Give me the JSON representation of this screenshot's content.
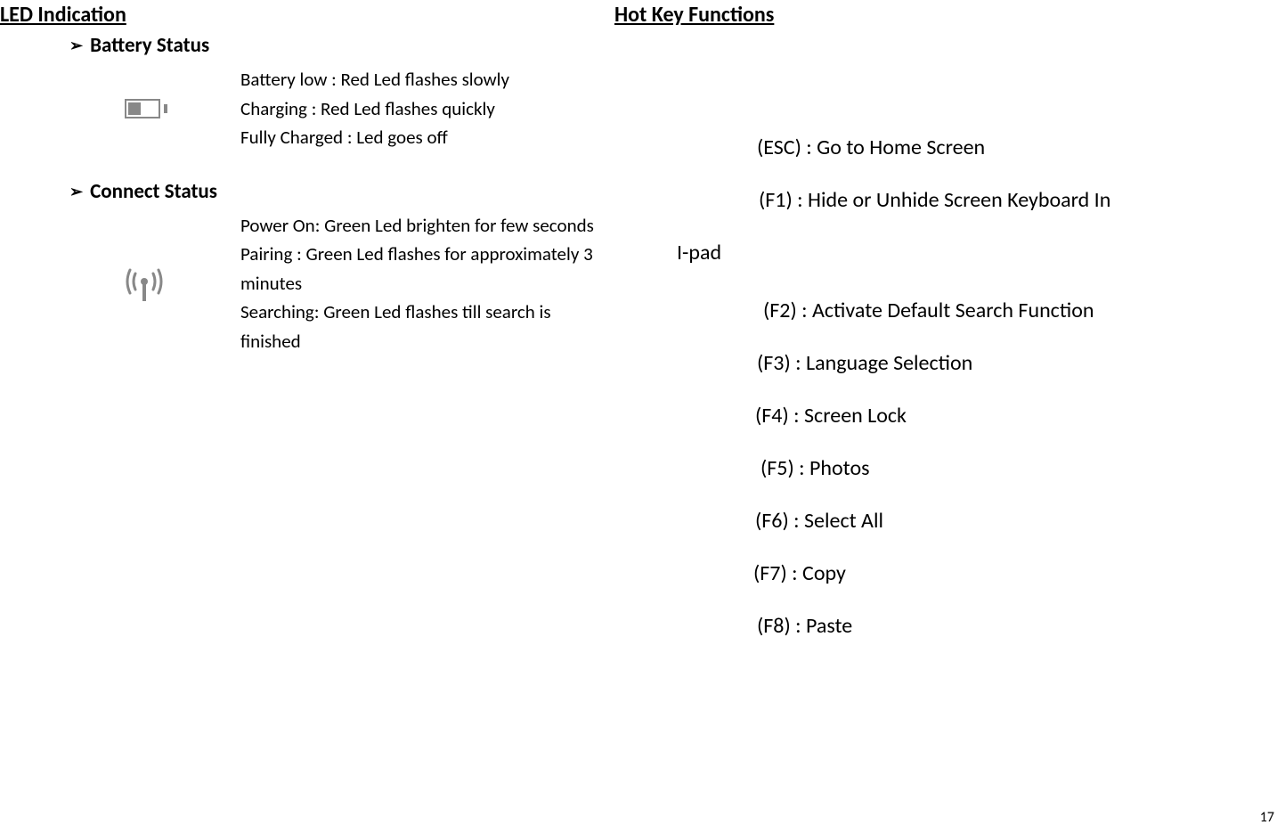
{
  "left": {
    "heading": "LED Indication",
    "battery": {
      "title": "Battery Status",
      "lines": [
        "Battery low : Red Led flashes slowly",
        "Charging : Red Led flashes quickly",
        "Fully Charged : Led goes off"
      ]
    },
    "connect": {
      "title": "Connect Status",
      "lines": [
        "Power On: Green Led brighten for few seconds",
        "Pairing   : Green Led flashes for approximately 3 minutes",
        "Searching: Green Led flashes till search is finished"
      ]
    }
  },
  "right": {
    "heading": "Hot Key Functions",
    "esc": "(ESC) : Go to Home Screen",
    "f1": "(F1) : Hide or Unhide Screen Keyboard In",
    "ipad": "I-pad",
    "f2": "(F2) : Activate Default Search Function",
    "f3": "(F3) : Language Selection",
    "f4": "(F4) : Screen Lock",
    "f5": "(F5) : Photos",
    "f6": "(F6) : Select All",
    "f7": "(F7) : Copy",
    "f8": "(F8) : Paste"
  },
  "pageNumber": "17",
  "icons": {
    "battery": "battery-low-icon",
    "wireless": "wireless-signal-icon"
  }
}
